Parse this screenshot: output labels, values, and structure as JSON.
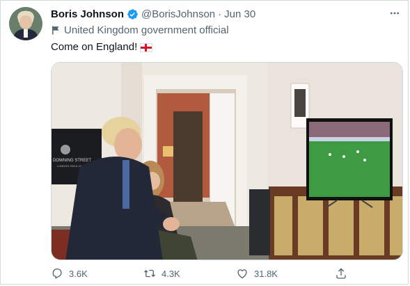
{
  "tweet": {
    "author_name": "Boris Johnson",
    "handle": "@BorisJohnson",
    "separator": "·",
    "date": "Jun 30",
    "label": "United Kingdom government official",
    "text": "Come on England!",
    "emoji": "england-flag",
    "more_icon": "more-icon"
  },
  "actions": {
    "reply_count": "3.6K",
    "retweet_count": "4.3K",
    "like_count": "31.8K",
    "icons": [
      "reply-icon",
      "retweet-icon",
      "like-icon",
      "share-icon"
    ]
  },
  "media": {
    "sign_text": "DOWNING STREET",
    "sign_sub": "LONDON SW1A 2AA"
  },
  "colors": {
    "text_primary": "#0f1419",
    "text_secondary": "#536471",
    "verified_blue": "#1d9bf0",
    "border": "#cfd9de"
  }
}
